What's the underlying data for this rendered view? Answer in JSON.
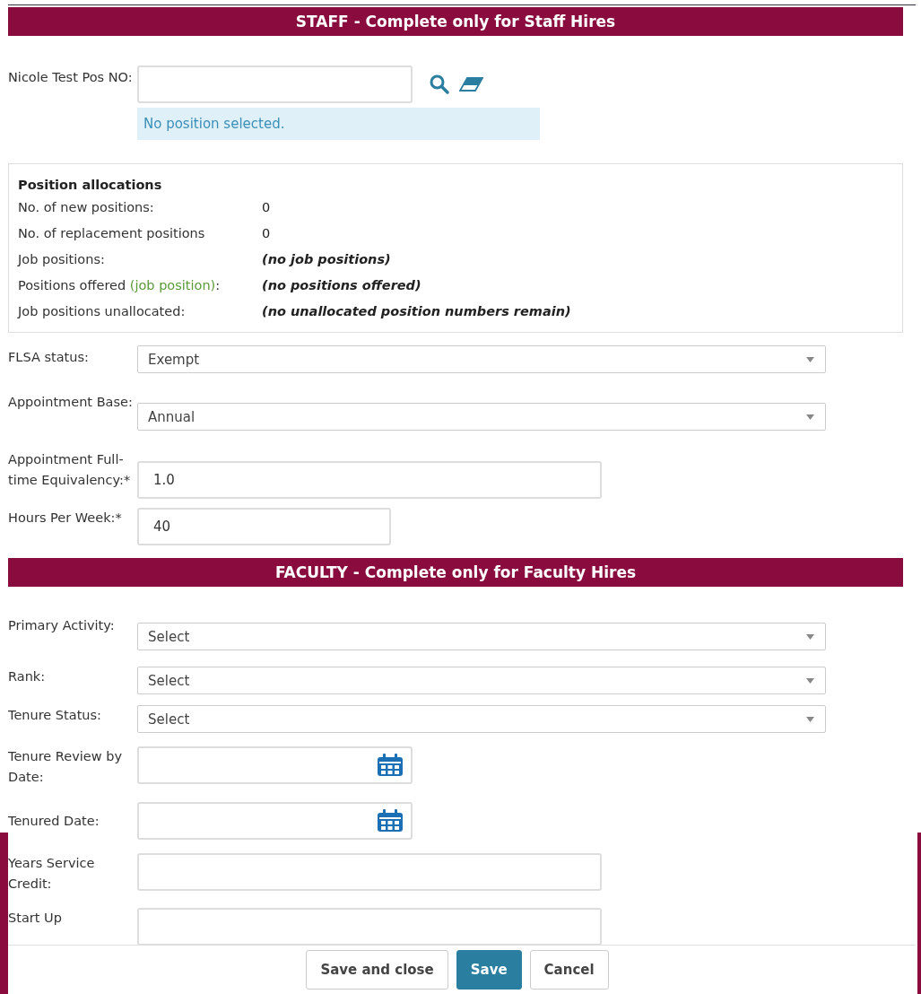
{
  "staff": {
    "title": "STAFF - Complete only for Staff Hires",
    "position_lookup": {
      "label": "Nicole Test Pos NO:",
      "message": "No position selected."
    },
    "allocations": {
      "title": "Position allocations",
      "rows": [
        {
          "label": "No. of new positions:",
          "value": "0",
          "kind": "plain"
        },
        {
          "label": "No. of replacement positions",
          "value": "0",
          "kind": "plain"
        },
        {
          "label": "Job positions:",
          "value": "(no job positions)",
          "kind": "note"
        },
        {
          "label": "Positions offered ",
          "label_note": "(job position)",
          "label_suffix": ":",
          "value": "(no positions offered)",
          "kind": "note"
        },
        {
          "label": "Job positions unallocated:",
          "value": "(no unallocated position numbers remain)",
          "kind": "note"
        }
      ]
    },
    "fields": [
      {
        "label": "FLSA status:",
        "kind": "select",
        "value": "Exempt"
      },
      {
        "label": "Appointment Base:",
        "kind": "select",
        "value": "Annual"
      },
      {
        "label": "Appointment Full-time Equivalency:*",
        "kind": "text",
        "value": "1.0"
      },
      {
        "label": "Hours Per Week:*",
        "kind": "short-text",
        "value": "40"
      }
    ]
  },
  "faculty": {
    "title": "FACULTY - Complete only for Faculty Hires",
    "fields": [
      {
        "label": "Primary Activity:",
        "kind": "select",
        "value": "Select"
      },
      {
        "label": "Rank:",
        "kind": "select",
        "value": "Select"
      },
      {
        "label": "Tenure Status:",
        "kind": "select",
        "value": "Select"
      },
      {
        "label": "Tenure Review by Date:",
        "kind": "date"
      },
      {
        "label": "Tenured Date:",
        "kind": "date"
      },
      {
        "label": "Years Service Credit:",
        "kind": "text"
      },
      {
        "label": "Start Up",
        "kind": "text"
      }
    ]
  },
  "buttons": [
    {
      "label": "Save and close",
      "primary": false
    },
    {
      "label": "Save",
      "primary": true
    },
    {
      "label": "Cancel",
      "primary": false
    }
  ]
}
